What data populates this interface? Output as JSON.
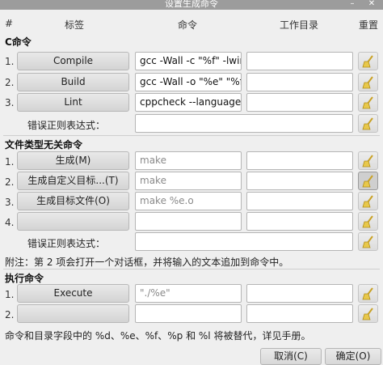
{
  "window": {
    "title": "设置生成命令"
  },
  "headers": {
    "num": "#",
    "label": "标签",
    "command": "命令",
    "workdir": "工作目录",
    "reset": "重置"
  },
  "c_section": {
    "title": "C命令",
    "rows": [
      {
        "num": "1.",
        "label": "Compile",
        "command": "gcc -Wall -c \"%f\" -lwiri",
        "workdir": ""
      },
      {
        "num": "2.",
        "label": "Build",
        "command": "gcc -Wall -o \"%e\" \"%f\" ",
        "workdir": ""
      },
      {
        "num": "3.",
        "label": "Lint",
        "command": "cppcheck --language=",
        "workdir": ""
      }
    ],
    "error_regex_label": "错误正则表达式：",
    "error_regex_value": ""
  },
  "indep_section": {
    "title": "文件类型无关命令",
    "rows": [
      {
        "num": "1.",
        "label": "生成(M)",
        "command": "make",
        "workdir": ""
      },
      {
        "num": "2.",
        "label": "生成自定义目标...(T)",
        "command": "make",
        "workdir": ""
      },
      {
        "num": "3.",
        "label": "生成目标文件(O)",
        "command": "make %e.o",
        "workdir": ""
      },
      {
        "num": "4.",
        "label": "",
        "command": "",
        "workdir": ""
      }
    ],
    "error_regex_label": "错误正则表达式：",
    "error_regex_value": ""
  },
  "note": "附注：第 2 项会打开一个对话框，并将输入的文本追加到命令中。",
  "exec_section": {
    "title": "执行命令",
    "rows": [
      {
        "num": "1.",
        "label": "Execute",
        "command": "\"./%e\"",
        "workdir": ""
      },
      {
        "num": "2.",
        "label": "",
        "command": "",
        "workdir": ""
      }
    ]
  },
  "footer_note": "命令和目录字段中的 %d、%e、%f、%p 和 %l 将被替代，详见手册。",
  "buttons": {
    "cancel": "取消(C)",
    "ok": "确定(O)"
  },
  "colors": {
    "broom_handle": "#c9a227",
    "broom_bristles": "#e8c84a"
  }
}
